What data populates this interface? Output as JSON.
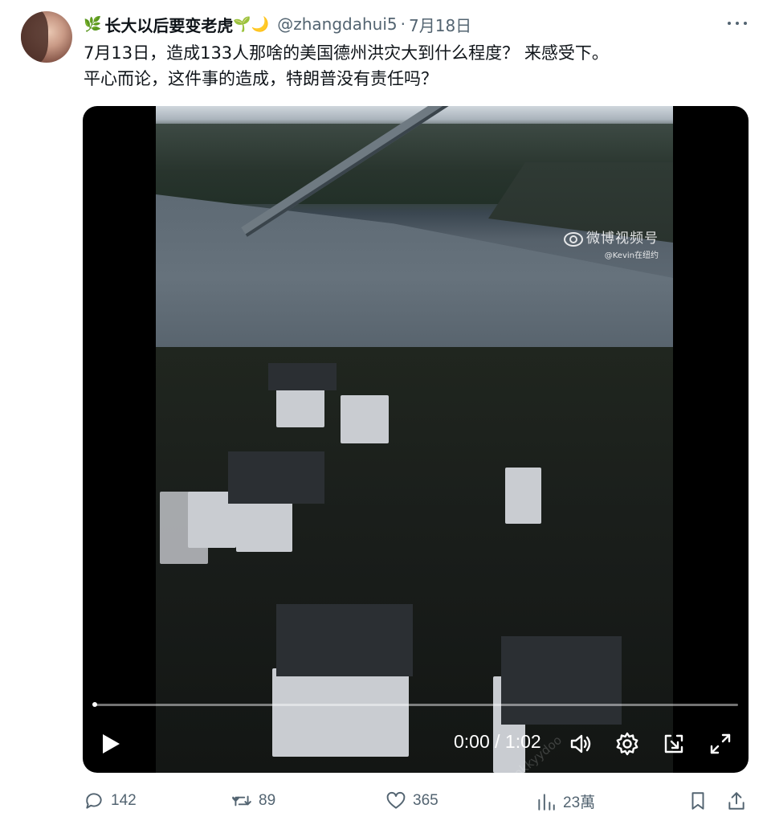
{
  "tweet": {
    "author": {
      "display_name": "长大以后要变老虎",
      "emoji_prefix": "🌿",
      "emoji_suffix": "🌱🌙",
      "handle": "@zhangdahui5",
      "separator": "·",
      "date": "7月18日"
    },
    "text_line1": "7月13日，造成133人那啥的美国德州洪灾大到什么程度？ 来感受下。",
    "text_line2": "平心而论，这件事的造成，特朗普没有责任吗？",
    "more_icon": "more-horizontal-icon"
  },
  "video": {
    "watermark_title": "微博视频号",
    "watermark_sub": "@Kevin在纽约",
    "watermark_lower": "Sooookkyydoo",
    "time_display": "0:00 / 1:02",
    "progress": 0.0,
    "icons": [
      "play-icon",
      "volume-icon",
      "settings-icon",
      "pip-icon",
      "fullscreen-icon"
    ]
  },
  "actions": {
    "replies": "142",
    "reposts": "89",
    "likes": "365",
    "views": "23萬"
  },
  "colors": {
    "text": "#0f1419",
    "muted": "#536471",
    "video_bg": "#000000"
  }
}
